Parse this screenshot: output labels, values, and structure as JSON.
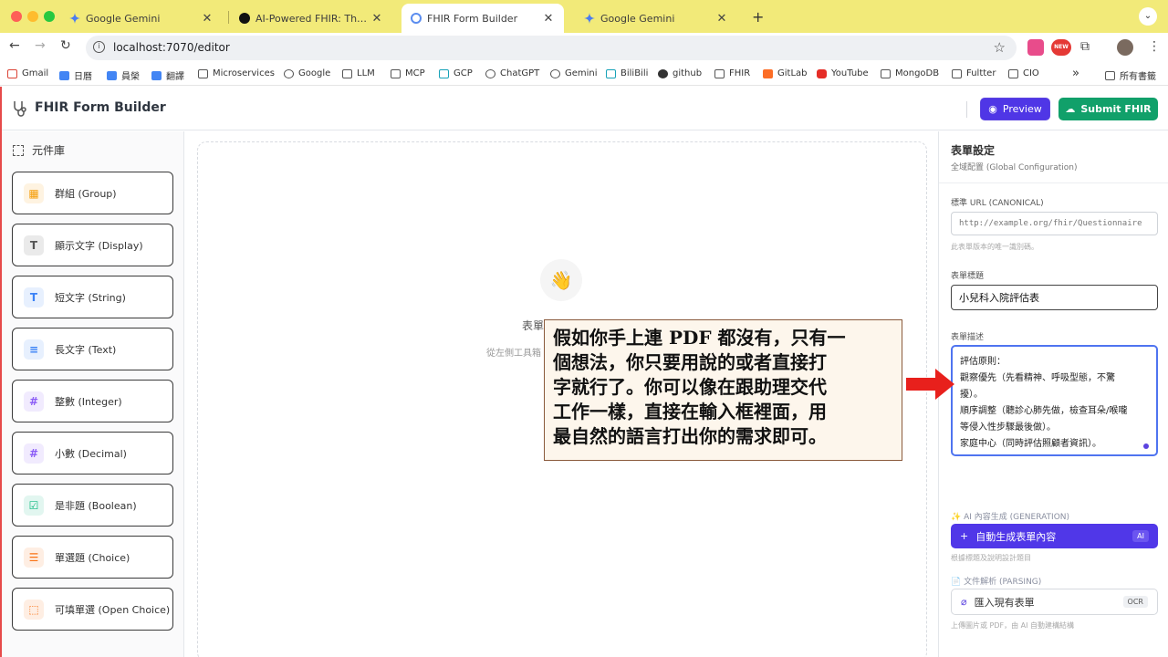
{
  "browser": {
    "tabs": [
      {
        "title": "Google Gemini",
        "icon": "gemini-icon"
      },
      {
        "title": "AI-Powered FHIR: The Future",
        "icon": "dark-circle-icon"
      },
      {
        "title": "FHIR Form Builder",
        "icon": "globe-icon",
        "active": true
      },
      {
        "title": "Google Gemini",
        "icon": "gemini-icon"
      }
    ],
    "url": "localhost:7070/editor",
    "bookmarks": [
      "Gmail",
      "日曆",
      "員榮",
      "翻譯",
      "Microservices",
      "Google",
      "LLM",
      "MCP",
      "GCP",
      "ChatGPT",
      "Gemini",
      "BiliBili",
      "github",
      "FHIR",
      "GitLab",
      "YouTube",
      "MongoDB",
      "Fultter",
      "CIO"
    ],
    "all_bookmarks": "所有書籤"
  },
  "header": {
    "title": "FHIR Form Builder",
    "preview_label": "Preview",
    "submit_label": "Submit FHIR"
  },
  "sidebar": {
    "title": "元件庫",
    "components": [
      {
        "label": "群組 (Group)",
        "icon": "group-icon",
        "glyph": "▦",
        "color": "#f59e0b"
      },
      {
        "label": "顯示文字 (Display)",
        "icon": "text-display-icon",
        "glyph": "T",
        "color": "#555555"
      },
      {
        "label": "短文字 (String)",
        "icon": "text-string-icon",
        "glyph": "T",
        "color": "#3b82f6"
      },
      {
        "label": "長文字 (Text)",
        "icon": "text-long-icon",
        "glyph": "≡",
        "color": "#3b82f6"
      },
      {
        "label": "整數 (Integer)",
        "icon": "hash-integer-icon",
        "glyph": "#",
        "color": "#8b5cf6"
      },
      {
        "label": "小數 (Decimal)",
        "icon": "hash-decimal-icon",
        "glyph": "#",
        "color": "#8b5cf6"
      },
      {
        "label": "是非題 (Boolean)",
        "icon": "checkbox-icon",
        "glyph": "☑",
        "color": "#10b981"
      },
      {
        "label": "單選題 (Choice)",
        "icon": "list-choice-icon",
        "glyph": "☰",
        "color": "#f97316"
      },
      {
        "label": "可填單選 (Open Choice)",
        "icon": "open-choice-icon",
        "glyph": "⬚",
        "color": "#f97316"
      }
    ]
  },
  "canvas": {
    "empty_title": "表單",
    "empty_hint": "從左側工具箱"
  },
  "settings": {
    "title": "表單設定",
    "subtitle": "全域配置 (Global Configuration)",
    "canonical_label": "標準 URL (CANONICAL)",
    "canonical_placeholder": "http://example.org/fhir/Questionnaire",
    "canonical_hint": "此表單版本的唯一識別碼。",
    "form_title_label": "表單標題",
    "form_title_value": "小兒科入院評估表",
    "desc_label": "表單描述",
    "desc_lines": [
      "評估原則：",
      "觀察優先（先看精神、呼吸型態，不驚",
      "擾）。",
      "順序調整（聽診心肺先做，檢查耳朵/喉嚨",
      "等侵入性步驟最後做）。",
      "家庭中心（同時評估照顧者資訊）。"
    ],
    "ai_section_label": "AI 內容生成 (GENERATION)",
    "ai_button_label": "自動生成表單內容",
    "ai_badge": "AI",
    "ai_hint": "根據標題及說明設計題目",
    "parse_section_label": "文件解析 (PARSING)",
    "import_label": "匯入現有表單",
    "import_badge": "OCR",
    "import_hint": "上傳圖片或 PDF，由 AI 自動建構結構"
  },
  "annotation": {
    "lines": [
      "假如你手上連 PDF 都沒有，只有一",
      "個想法，你只要用說的或者直接打",
      "字就行了。你可以像在跟助理交代",
      "工作一樣，直接在輸入框裡面，用",
      "最自然的語言打出你的需求即可。"
    ],
    "arrow_color": "#e8201c"
  }
}
